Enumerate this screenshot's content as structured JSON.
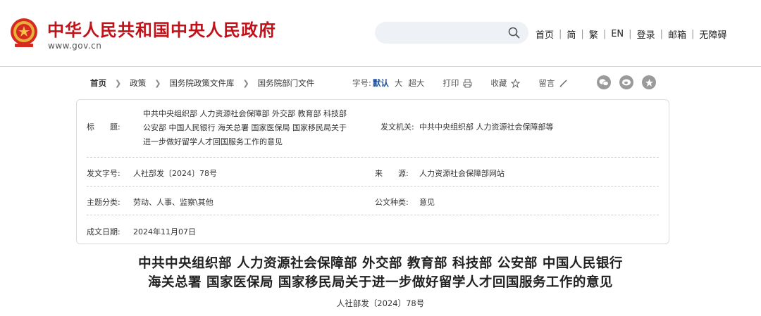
{
  "header": {
    "site_title": "中华人民共和国中央人民政府",
    "site_url": "www.gov.cn",
    "search_placeholder": "",
    "nav": [
      "首页",
      "简",
      "繁",
      "EN",
      "登录",
      "邮箱",
      "无障碍"
    ],
    "brand_color": "#c1121a"
  },
  "breadcrumb": {
    "items": [
      "首页",
      "政策",
      "国务院政策文件库",
      "国务院部门文件"
    ]
  },
  "tools": {
    "font_size_label": "字号:",
    "font_size_active": "默认",
    "font_size_large": "大",
    "font_size_xlarge": "超大",
    "print_label": "打印",
    "favorite_label": "收藏",
    "comment_label": "留言"
  },
  "share": {
    "icons": [
      "wechat-icon",
      "weibo-icon",
      "star-icon"
    ]
  },
  "info": {
    "title_label": "标　　题:",
    "title_lines": [
      "中共中央组织部  人力资源社会保障部  外交部  教育部  科技部",
      "公安部  中国人民银行  海关总署  国家医保局  国家移民局关于",
      "进一步做好留学人才回国服务工作的意见"
    ],
    "issuer_label": "发文机关:",
    "issuer_value": "中共中央组织部  人力资源社会保障部等",
    "doc_no_label": "发文字号:",
    "doc_no_value": "人社部发〔2024〕78号",
    "source_label": "来　　源:",
    "source_value": "人力资源社会保障部网站",
    "topic_label": "主题分类:",
    "topic_value": "劳动、人事、监察\\其他",
    "type_label": "公文种类:",
    "type_value": "意见",
    "date_label": "成文日期:",
    "date_value": "2024年11月07日"
  },
  "doc": {
    "title_line1": "中共中央组织部  人力资源社会保障部  外交部  教育部  科技部  公安部  中国人民银行",
    "title_line2": "海关总署  国家医保局  国家移民局关于进一步做好留学人才回国服务工作的意见",
    "number": "人社部发〔2024〕78号"
  }
}
